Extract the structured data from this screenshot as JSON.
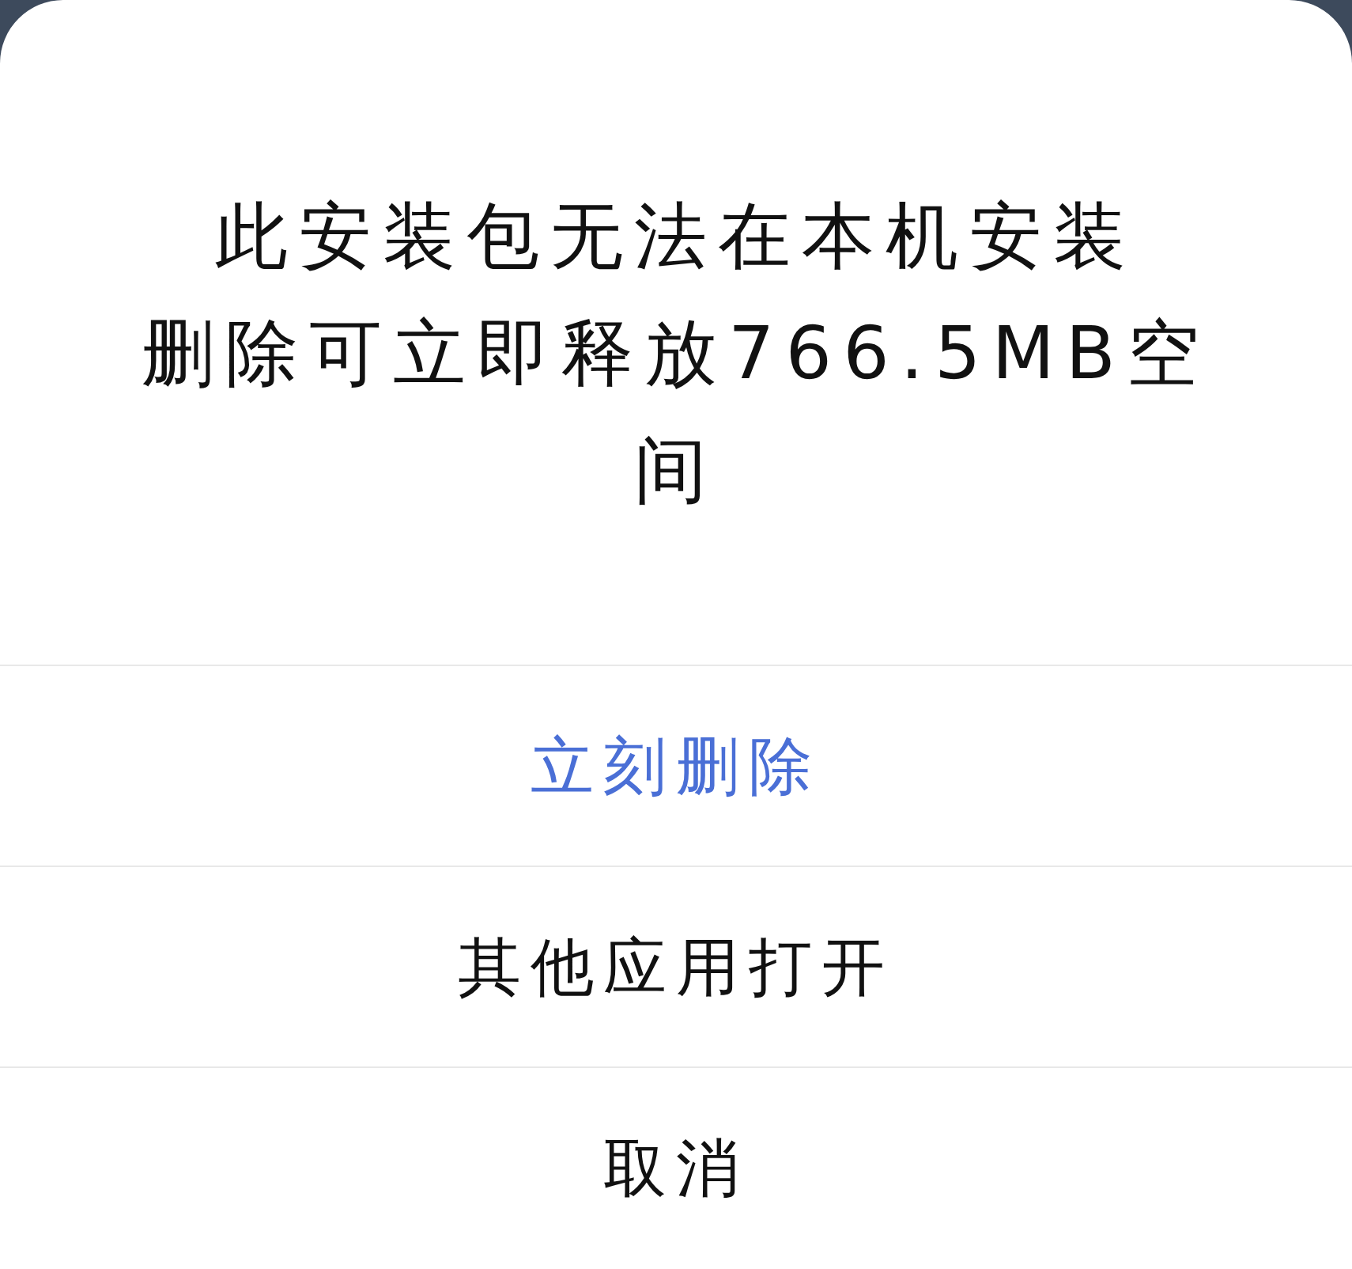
{
  "dialog": {
    "message_lines": [
      "此安装包无法在本机安装",
      "删除可立即释放766.5MB空间"
    ],
    "actions": [
      {
        "label": "立刻删除",
        "kind": "primary"
      },
      {
        "label": "其他应用打开",
        "kind": "normal"
      },
      {
        "label": "取消",
        "kind": "normal"
      }
    ]
  }
}
